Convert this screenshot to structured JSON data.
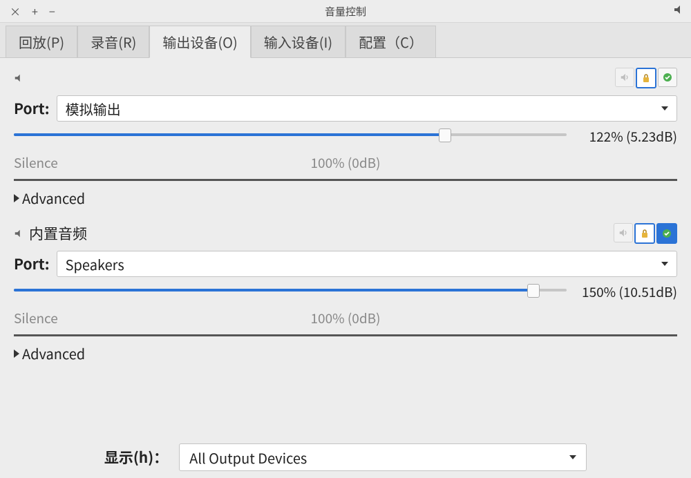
{
  "window": {
    "title": "音量控制"
  },
  "tabs": [
    {
      "label": "回放(P)",
      "active": false
    },
    {
      "label": "录音(R)",
      "active": false
    },
    {
      "label": "输出设备(O)",
      "active": true
    },
    {
      "label": "输入设备(I)",
      "active": false
    },
    {
      "label": "配置（C）",
      "active": false
    }
  ],
  "labels": {
    "port": "Port:",
    "silence": "Silence",
    "hundred": "100% (0dB)",
    "advanced": "Advanced",
    "show": "显示(h)："
  },
  "devices": [
    {
      "name": "",
      "port_value": "模拟输出",
      "volume_text": "122% (5.23dB)",
      "fill_pct": 78,
      "thumb_pct": 78,
      "default": false
    },
    {
      "name": "内置音频",
      "port_value": "Speakers",
      "volume_text": "150% (10.51dB)",
      "fill_pct": 94,
      "thumb_pct": 94,
      "default": true
    }
  ],
  "footer_select": "All Output Devices"
}
